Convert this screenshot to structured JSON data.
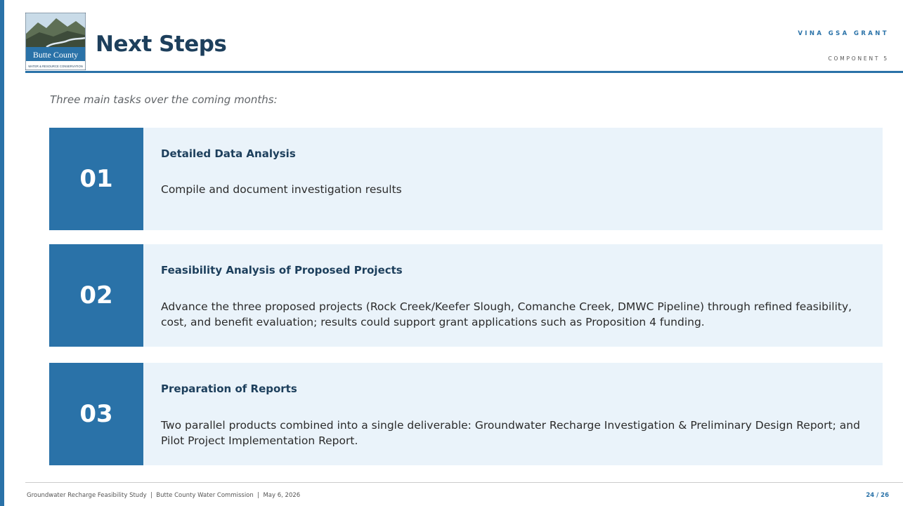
{
  "header": {
    "title": "Next Steps",
    "brand_title": "VINA GSA GRANT",
    "brand_subtitle": "COMPONENT 5",
    "logo": {
      "name": "Butte County",
      "tagline": "WATER & RESOURCE CONSERVATION"
    }
  },
  "intro": "Three main tasks over the coming months:",
  "steps": [
    {
      "number": "01",
      "title": "Detailed Data Analysis",
      "description": "Compile and document investigation results"
    },
    {
      "number": "02",
      "title": "Feasibility Analysis of Proposed Projects",
      "description": "Advance the three proposed projects (Rock Creek/Keefer Slough, Comanche Creek, DMWC Pipeline) through refined feasibility, cost, and benefit evaluation; results could support grant applications such as Proposition 4 funding."
    },
    {
      "number": "03",
      "title": "Preparation of Reports",
      "description": "Two parallel products combined into a single deliverable: Groundwater Recharge Investigation & Preliminary Design Report; and Pilot Project Implementation Report."
    }
  ],
  "footer": {
    "left": "Groundwater Recharge Feasibility Study  |  Butte County Water Commission  |  May 6, 2026",
    "page": "24 / 26"
  },
  "colors": {
    "accent": "#2a72a8",
    "title": "#1d3f5c",
    "card_bg": "#eaf3fa"
  }
}
